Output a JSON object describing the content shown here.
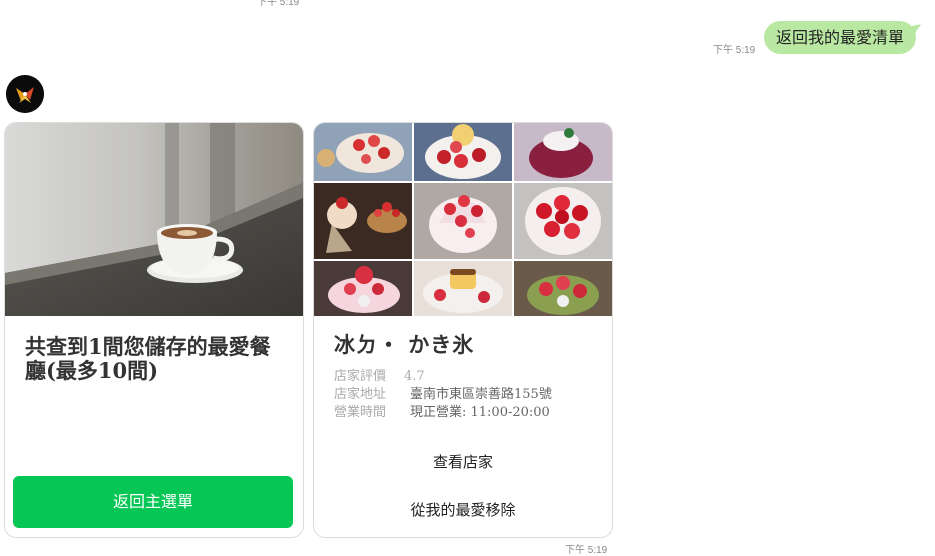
{
  "top_partial_time": "下午 5:19",
  "outgoing": {
    "text": "返回我的最愛清單",
    "time": "下午 5:19"
  },
  "cards": {
    "summary": {
      "title": "共查到1間您儲存的最愛餐廳(最多10間)",
      "button": "返回主選單"
    },
    "restaurant": {
      "name": "冰ㄉ・ かき氷",
      "info": [
        {
          "key": "店家評價",
          "value": "4.7"
        },
        {
          "key": "店家地址",
          "value": "臺南市東區崇善路155號"
        },
        {
          "key": "營業時間",
          "value": "現正營業: 11:00-20:00"
        }
      ],
      "view_button": "查看店家",
      "remove_button": "從我的最愛移除"
    }
  },
  "bottom_time": "下午 5:19",
  "colors": {
    "green_button": "#06c755",
    "bubble": "#b9e8a2"
  }
}
